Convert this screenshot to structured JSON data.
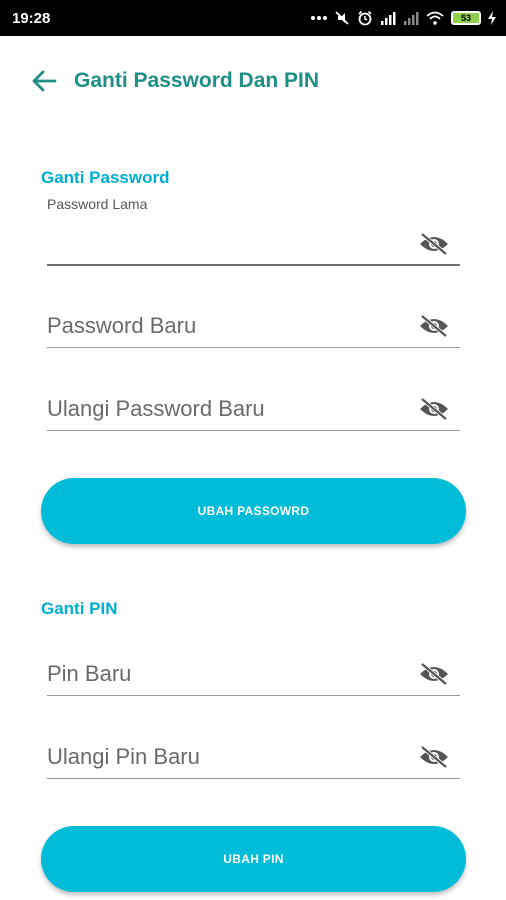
{
  "status_bar": {
    "time": "19:28",
    "battery": "53",
    "icons": [
      "more-dots-icon",
      "mute-icon",
      "alarm-icon",
      "signal-icon",
      "signal-icon",
      "wifi-icon",
      "battery-icon",
      "charging-icon"
    ]
  },
  "header": {
    "title": "Ganti Password Dan PIN",
    "back_icon": "arrow-left-icon"
  },
  "password_section": {
    "title": "Ganti Password",
    "old_password": {
      "label": "Password Lama",
      "value": "",
      "placeholder": ""
    },
    "new_password": {
      "placeholder": "Password Baru",
      "value": ""
    },
    "repeat_password": {
      "placeholder": "Ulangi Password Baru",
      "value": ""
    },
    "submit_label": "UBAH PASSOWRD"
  },
  "pin_section": {
    "title": "Ganti PIN",
    "new_pin": {
      "placeholder": "Pin Baru",
      "value": ""
    },
    "repeat_pin": {
      "placeholder": "Ulangi Pin Baru",
      "value": ""
    },
    "submit_label": "UBAH PIN"
  },
  "colors": {
    "title": "#1e8f86",
    "section_title": "#00aed1",
    "button": "#00bcd8",
    "status_bar": "#000000"
  }
}
